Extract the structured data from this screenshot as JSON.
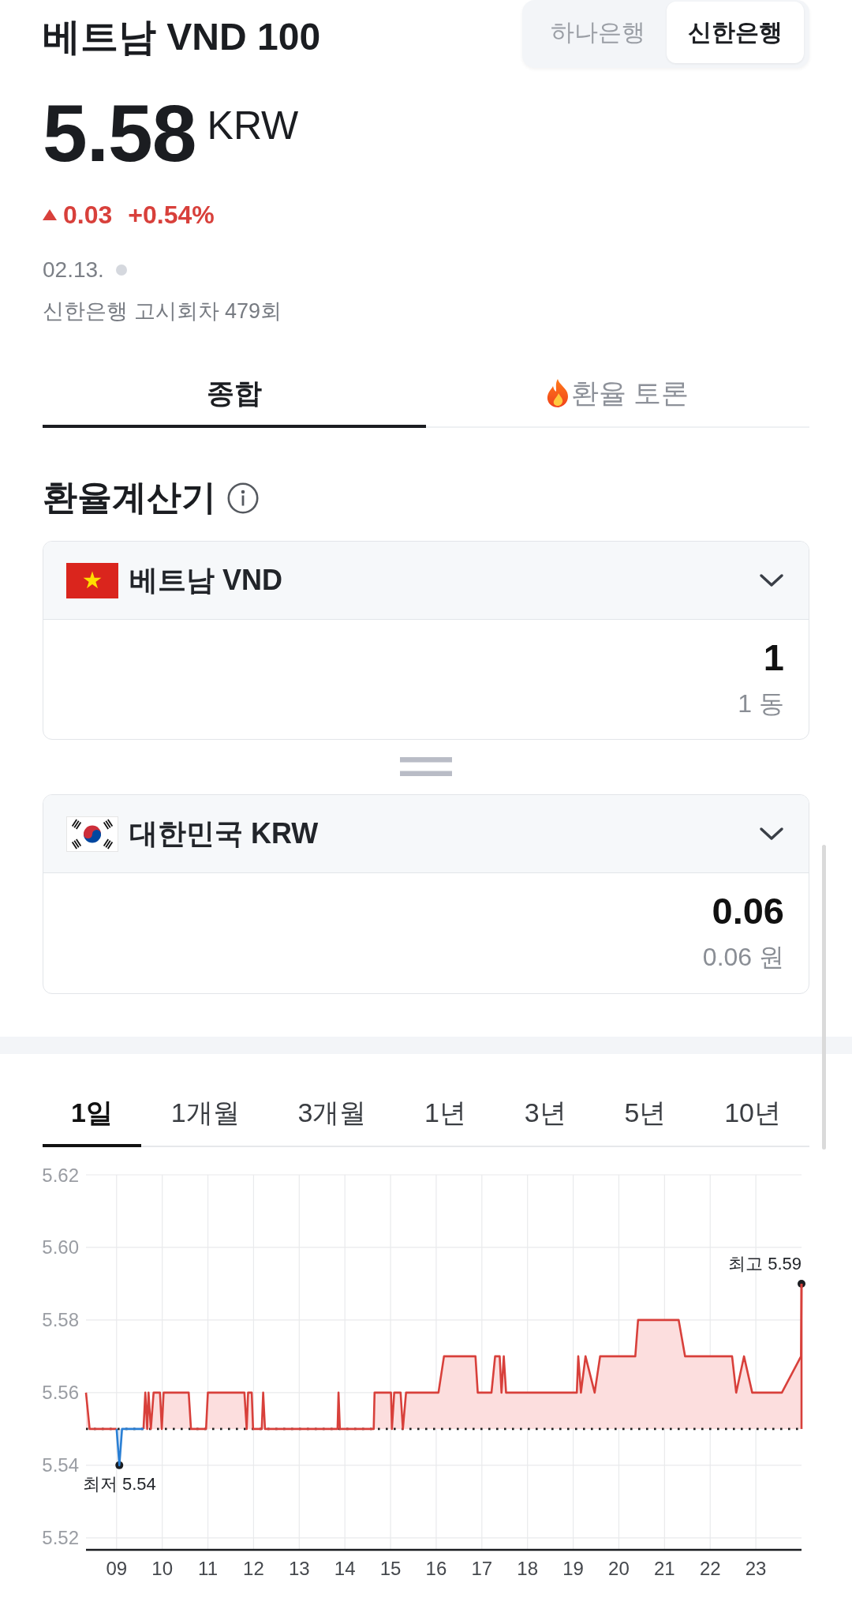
{
  "header": {
    "title": "베트남 VND 100",
    "bank_toggle": [
      {
        "label": "하나은행",
        "selected": false
      },
      {
        "label": "신한은행",
        "selected": true
      }
    ]
  },
  "quote": {
    "price": "5.58",
    "currency": "KRW",
    "up": true,
    "change": "0.03",
    "change_percent": "+0.54%",
    "date": "02.13.",
    "notice": "신한은행 고시회차 479회"
  },
  "tabs": [
    {
      "label": "종합",
      "kind": "plain",
      "selected": true
    },
    {
      "label": "환율 토론",
      "kind": "hot",
      "selected": false
    }
  ],
  "calculator": {
    "title": "환율계산기",
    "currencies": [
      {
        "kind": "vietnam",
        "name": "베트남 VND",
        "amount": "1",
        "amount_text": "1 동"
      },
      {
        "kind": "korea",
        "name": "대한민국 KRW",
        "amount": "0.06",
        "amount_text": "0.06 원"
      }
    ]
  },
  "period_tabs": [
    {
      "label": "1일",
      "selected": true
    },
    {
      "label": "1개월",
      "selected": false
    },
    {
      "label": "3개월",
      "selected": false
    },
    {
      "label": "1년",
      "selected": false
    },
    {
      "label": "3년",
      "selected": false
    },
    {
      "label": "5년",
      "selected": false
    },
    {
      "label": "10년",
      "selected": false
    }
  ],
  "chart": {
    "chart_data": {
      "type": "line",
      "grid": true,
      "x": [
        8.33,
        8.41,
        9.0,
        9.06,
        9.12,
        9.59,
        9.63,
        9.67,
        9.7,
        9.75,
        9.81,
        9.95,
        9.99,
        10.03,
        10.58,
        10.63,
        10.96,
        11.0,
        11.8,
        11.85,
        11.88,
        11.96,
        11.99,
        12.18,
        12.21,
        12.25,
        13.84,
        13.86,
        13.89,
        14.63,
        14.65,
        15.01,
        15.03,
        15.08,
        15.22,
        15.27,
        15.34,
        16.05,
        16.17,
        16.86,
        16.91,
        17.21,
        17.29,
        17.39,
        17.43,
        17.48,
        17.53,
        19.08,
        19.11,
        19.17,
        19.27,
        19.47,
        19.59,
        20.36,
        20.42,
        21.31,
        21.45,
        22.48,
        22.57,
        22.74,
        22.92,
        23.57,
        23.99,
        24.0
      ],
      "series": [
        {
          "color": "#d8403b",
          "values": [
            5.56,
            5.55,
            5.55,
            null,
            null,
            5.55,
            5.56,
            5.55,
            5.56,
            5.55,
            5.56,
            5.56,
            5.55,
            5.56,
            5.56,
            5.55,
            5.55,
            5.56,
            5.56,
            5.55,
            5.56,
            5.56,
            5.55,
            5.55,
            5.56,
            5.55,
            5.55,
            5.56,
            5.55,
            5.55,
            5.56,
            5.56,
            5.55,
            5.56,
            5.56,
            5.55,
            5.56,
            5.56,
            5.57,
            5.57,
            5.56,
            5.56,
            5.57,
            5.57,
            5.56,
            5.57,
            5.56,
            5.56,
            5.57,
            5.56,
            5.57,
            5.56,
            5.57,
            5.57,
            5.58,
            5.58,
            5.57,
            5.57,
            5.56,
            5.57,
            5.56,
            5.56,
            5.57,
            5.59
          ]
        },
        {
          "color": "#2a7fd4",
          "values": [
            null,
            null,
            5.55,
            5.54,
            5.55,
            5.55,
            null,
            null,
            null,
            null,
            null,
            null,
            null,
            null,
            null,
            null,
            null,
            null,
            null,
            null,
            null,
            null,
            null,
            null,
            null,
            null,
            null,
            null,
            null,
            null,
            null,
            null,
            null,
            null,
            null,
            null,
            null,
            null,
            null,
            null,
            null,
            null,
            null,
            null,
            null,
            null,
            null,
            null,
            null,
            null,
            null,
            null,
            null,
            null,
            null,
            null,
            null,
            null,
            null,
            null,
            null,
            null,
            null,
            null
          ]
        }
      ],
      "xlim": [
        8.33,
        24.0
      ],
      "ylim": [
        5.5167,
        5.62
      ],
      "xticks": [
        {
          "value": 9,
          "label": "09"
        },
        {
          "value": 10,
          "label": "10"
        },
        {
          "value": 11,
          "label": "11"
        },
        {
          "value": 12,
          "label": "12"
        },
        {
          "value": 13,
          "label": "13"
        },
        {
          "value": 14,
          "label": "14"
        },
        {
          "value": 15,
          "label": "15"
        },
        {
          "value": 16,
          "label": "16"
        },
        {
          "value": 17,
          "label": "17"
        },
        {
          "value": 18,
          "label": "18"
        },
        {
          "value": 19,
          "label": "19"
        },
        {
          "value": 20,
          "label": "20"
        },
        {
          "value": 21,
          "label": "21"
        },
        {
          "value": 22,
          "label": "22"
        },
        {
          "value": 23,
          "label": "23"
        }
      ],
      "yticks": [
        {
          "value": 5.52,
          "label": "5.52"
        },
        {
          "value": 5.54,
          "label": "5.54"
        },
        {
          "value": 5.56,
          "label": "5.56"
        },
        {
          "value": 5.58,
          "label": "5.58"
        },
        {
          "value": 5.6,
          "label": "5.60"
        },
        {
          "value": 5.62,
          "label": "5.62"
        }
      ],
      "ref_lines": [
        {
          "axis": "y",
          "value": 5.55
        }
      ],
      "annotations": [
        {
          "text": "최고 5.59",
          "x": 24.0,
          "y": 5.59
        },
        {
          "text": "최저 5.54",
          "x": 9.06,
          "y": 5.54
        }
      ]
    }
  }
}
